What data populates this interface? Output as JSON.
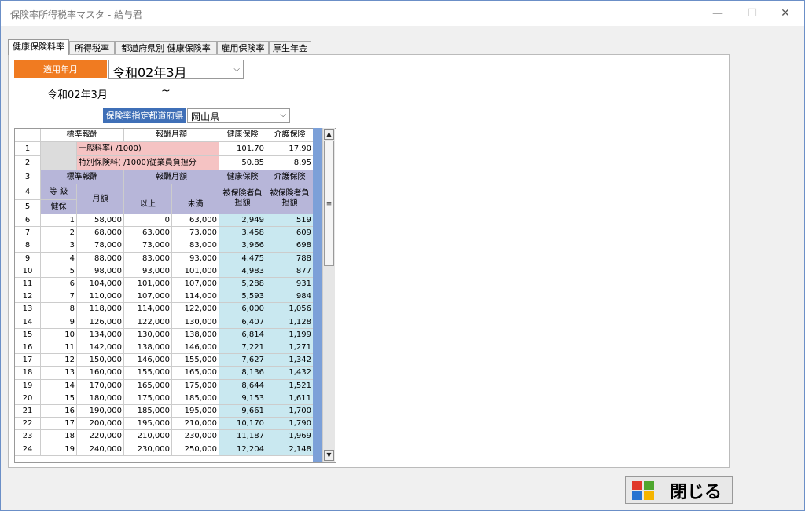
{
  "window": {
    "title": "保険率所得税率マスタ - 給与君",
    "minimize": "—",
    "maximize": "☐",
    "close": "✕"
  },
  "tabs": [
    "健康保険料率",
    "所得税率",
    "都道府県別 健康保険率",
    "雇用保険率",
    "厚生年金"
  ],
  "apply_month": {
    "label": "適用年月",
    "value": "令和02年3月",
    "start_text": "令和02年3月",
    "tilde": "~"
  },
  "prefecture": {
    "label": "保険率指定都道府県",
    "value": "岡山県"
  },
  "grid": {
    "top_header": {
      "standard": "標準報酬",
      "monthly": "報酬月額",
      "health": "健康保険",
      "care": "介護保険"
    },
    "rate_rows": [
      {
        "rn": "1",
        "label": "一般料率(  /1000)",
        "health": "101.70",
        "care": "17.90"
      },
      {
        "rn": "2",
        "label": "特別保険料(  /1000)従業員負担分",
        "health": "50.85",
        "care": "8.95"
      }
    ],
    "subheader": {
      "rn3": "3",
      "rn4": "4",
      "rn5": "5",
      "standard": "標準報酬",
      "monthly": "報酬月額",
      "health": "健康保険",
      "care": "介護保険",
      "grade": "等  級",
      "grade_sub": "健保",
      "month_amount": "月額",
      "from": "以上",
      "to": "未満",
      "health_burden": "被保険者負担額",
      "care_burden": "被保険者負担額"
    },
    "rows": [
      [
        "6",
        "1",
        "58,000",
        "0",
        "63,000",
        "2,949",
        "519"
      ],
      [
        "7",
        "2",
        "68,000",
        "63,000",
        "73,000",
        "3,458",
        "609"
      ],
      [
        "8",
        "3",
        "78,000",
        "73,000",
        "83,000",
        "3,966",
        "698"
      ],
      [
        "9",
        "4",
        "88,000",
        "83,000",
        "93,000",
        "4,475",
        "788"
      ],
      [
        "10",
        "5",
        "98,000",
        "93,000",
        "101,000",
        "4,983",
        "877"
      ],
      [
        "11",
        "6",
        "104,000",
        "101,000",
        "107,000",
        "5,288",
        "931"
      ],
      [
        "12",
        "7",
        "110,000",
        "107,000",
        "114,000",
        "5,593",
        "984"
      ],
      [
        "13",
        "8",
        "118,000",
        "114,000",
        "122,000",
        "6,000",
        "1,056"
      ],
      [
        "14",
        "9",
        "126,000",
        "122,000",
        "130,000",
        "6,407",
        "1,128"
      ],
      [
        "15",
        "10",
        "134,000",
        "130,000",
        "138,000",
        "6,814",
        "1,199"
      ],
      [
        "16",
        "11",
        "142,000",
        "138,000",
        "146,000",
        "7,221",
        "1,271"
      ],
      [
        "17",
        "12",
        "150,000",
        "146,000",
        "155,000",
        "7,627",
        "1,342"
      ],
      [
        "18",
        "13",
        "160,000",
        "155,000",
        "165,000",
        "8,136",
        "1,432"
      ],
      [
        "19",
        "14",
        "170,000",
        "165,000",
        "175,000",
        "8,644",
        "1,521"
      ],
      [
        "20",
        "15",
        "180,000",
        "175,000",
        "185,000",
        "9,153",
        "1,611"
      ],
      [
        "21",
        "16",
        "190,000",
        "185,000",
        "195,000",
        "9,661",
        "1,700"
      ],
      [
        "22",
        "17",
        "200,000",
        "195,000",
        "210,000",
        "10,170",
        "1,790"
      ],
      [
        "23",
        "18",
        "220,000",
        "210,000",
        "230,000",
        "11,187",
        "1,969"
      ],
      [
        "24",
        "19",
        "240,000",
        "230,000",
        "250,000",
        "12,204",
        "2,148"
      ]
    ]
  },
  "close_button": {
    "label": "閉じる"
  },
  "icons": {
    "dropdown": "chevron-down-icon",
    "app": "windows-logo-icon"
  }
}
